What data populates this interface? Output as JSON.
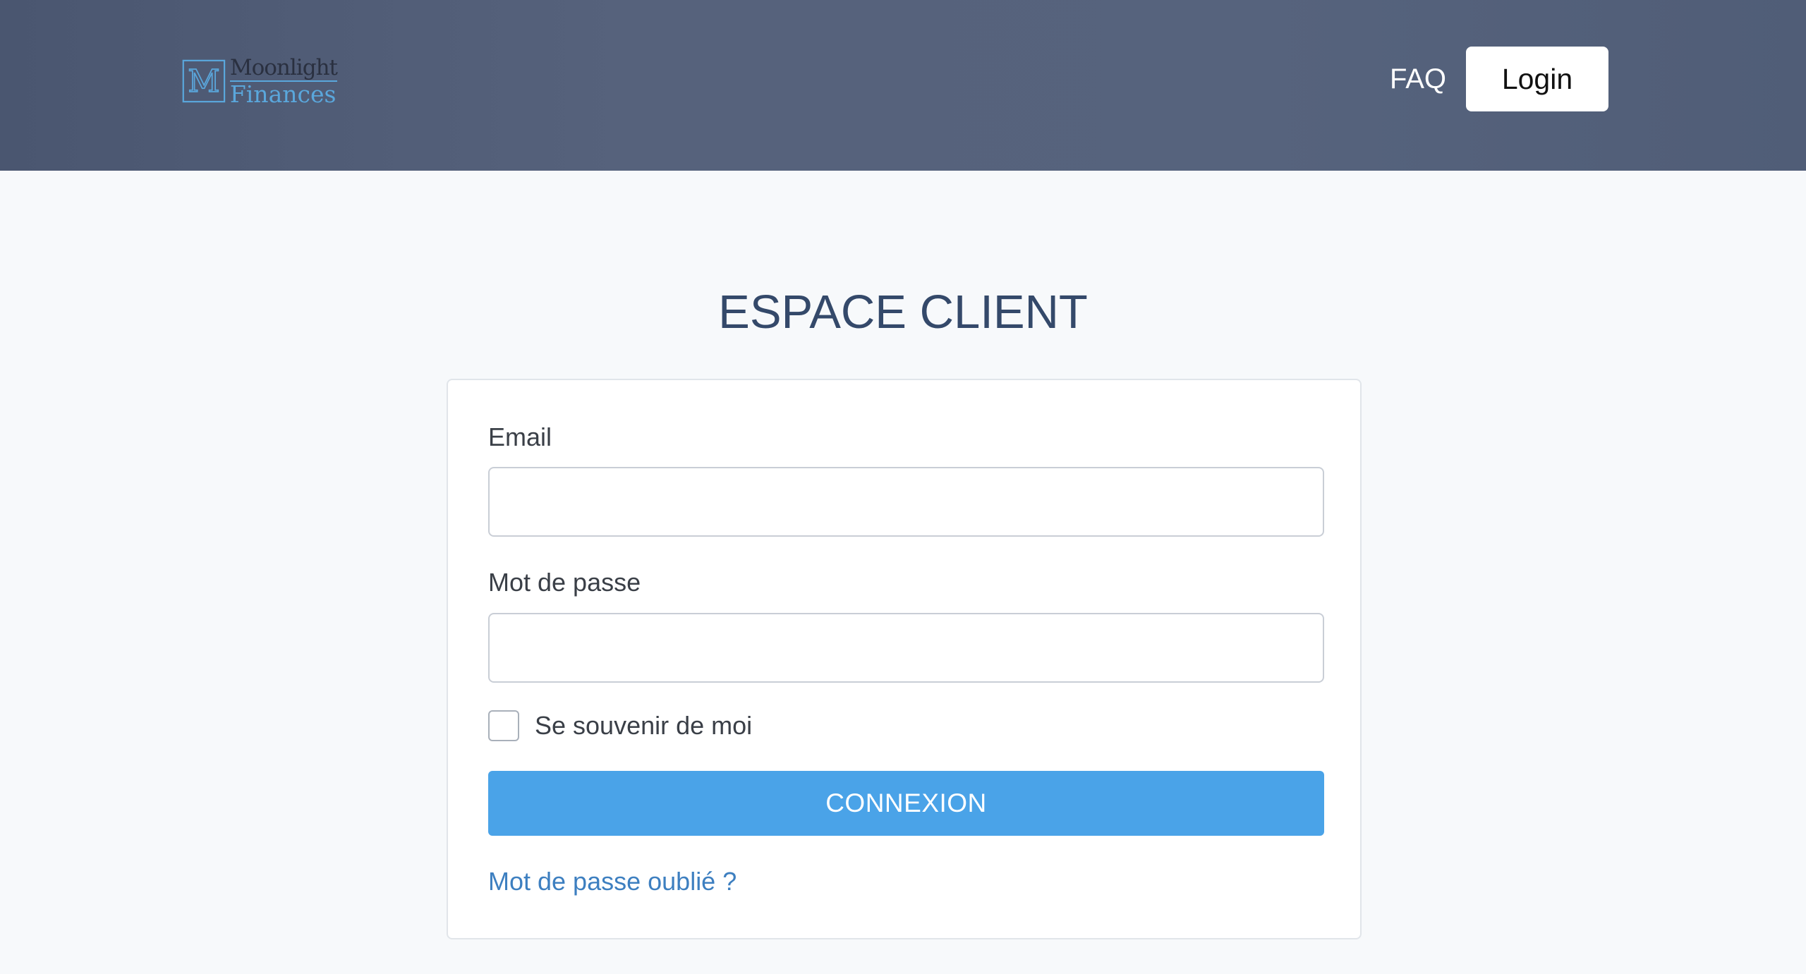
{
  "header": {
    "logo": {
      "line1": "Moonlight",
      "line2": "Finances",
      "mark": "M"
    },
    "nav": {
      "faq_label": "FAQ",
      "login_label": "Login"
    }
  },
  "main": {
    "title": "ESPACE CLIENT",
    "form": {
      "email_label": "Email",
      "email_value": "",
      "password_label": "Mot de passe",
      "password_value": "",
      "remember_label": "Se souvenir de moi",
      "remember_checked": false,
      "submit_label": "CONNEXION",
      "forgot_label": "Mot de passe oublié ?"
    }
  },
  "colors": {
    "header_bg": "#525e78",
    "page_bg": "#f7f9fb",
    "title": "#34496a",
    "primary_button": "#4aa3e8",
    "link": "#3d7fc0",
    "logo_accent": "#5aa7dc"
  }
}
